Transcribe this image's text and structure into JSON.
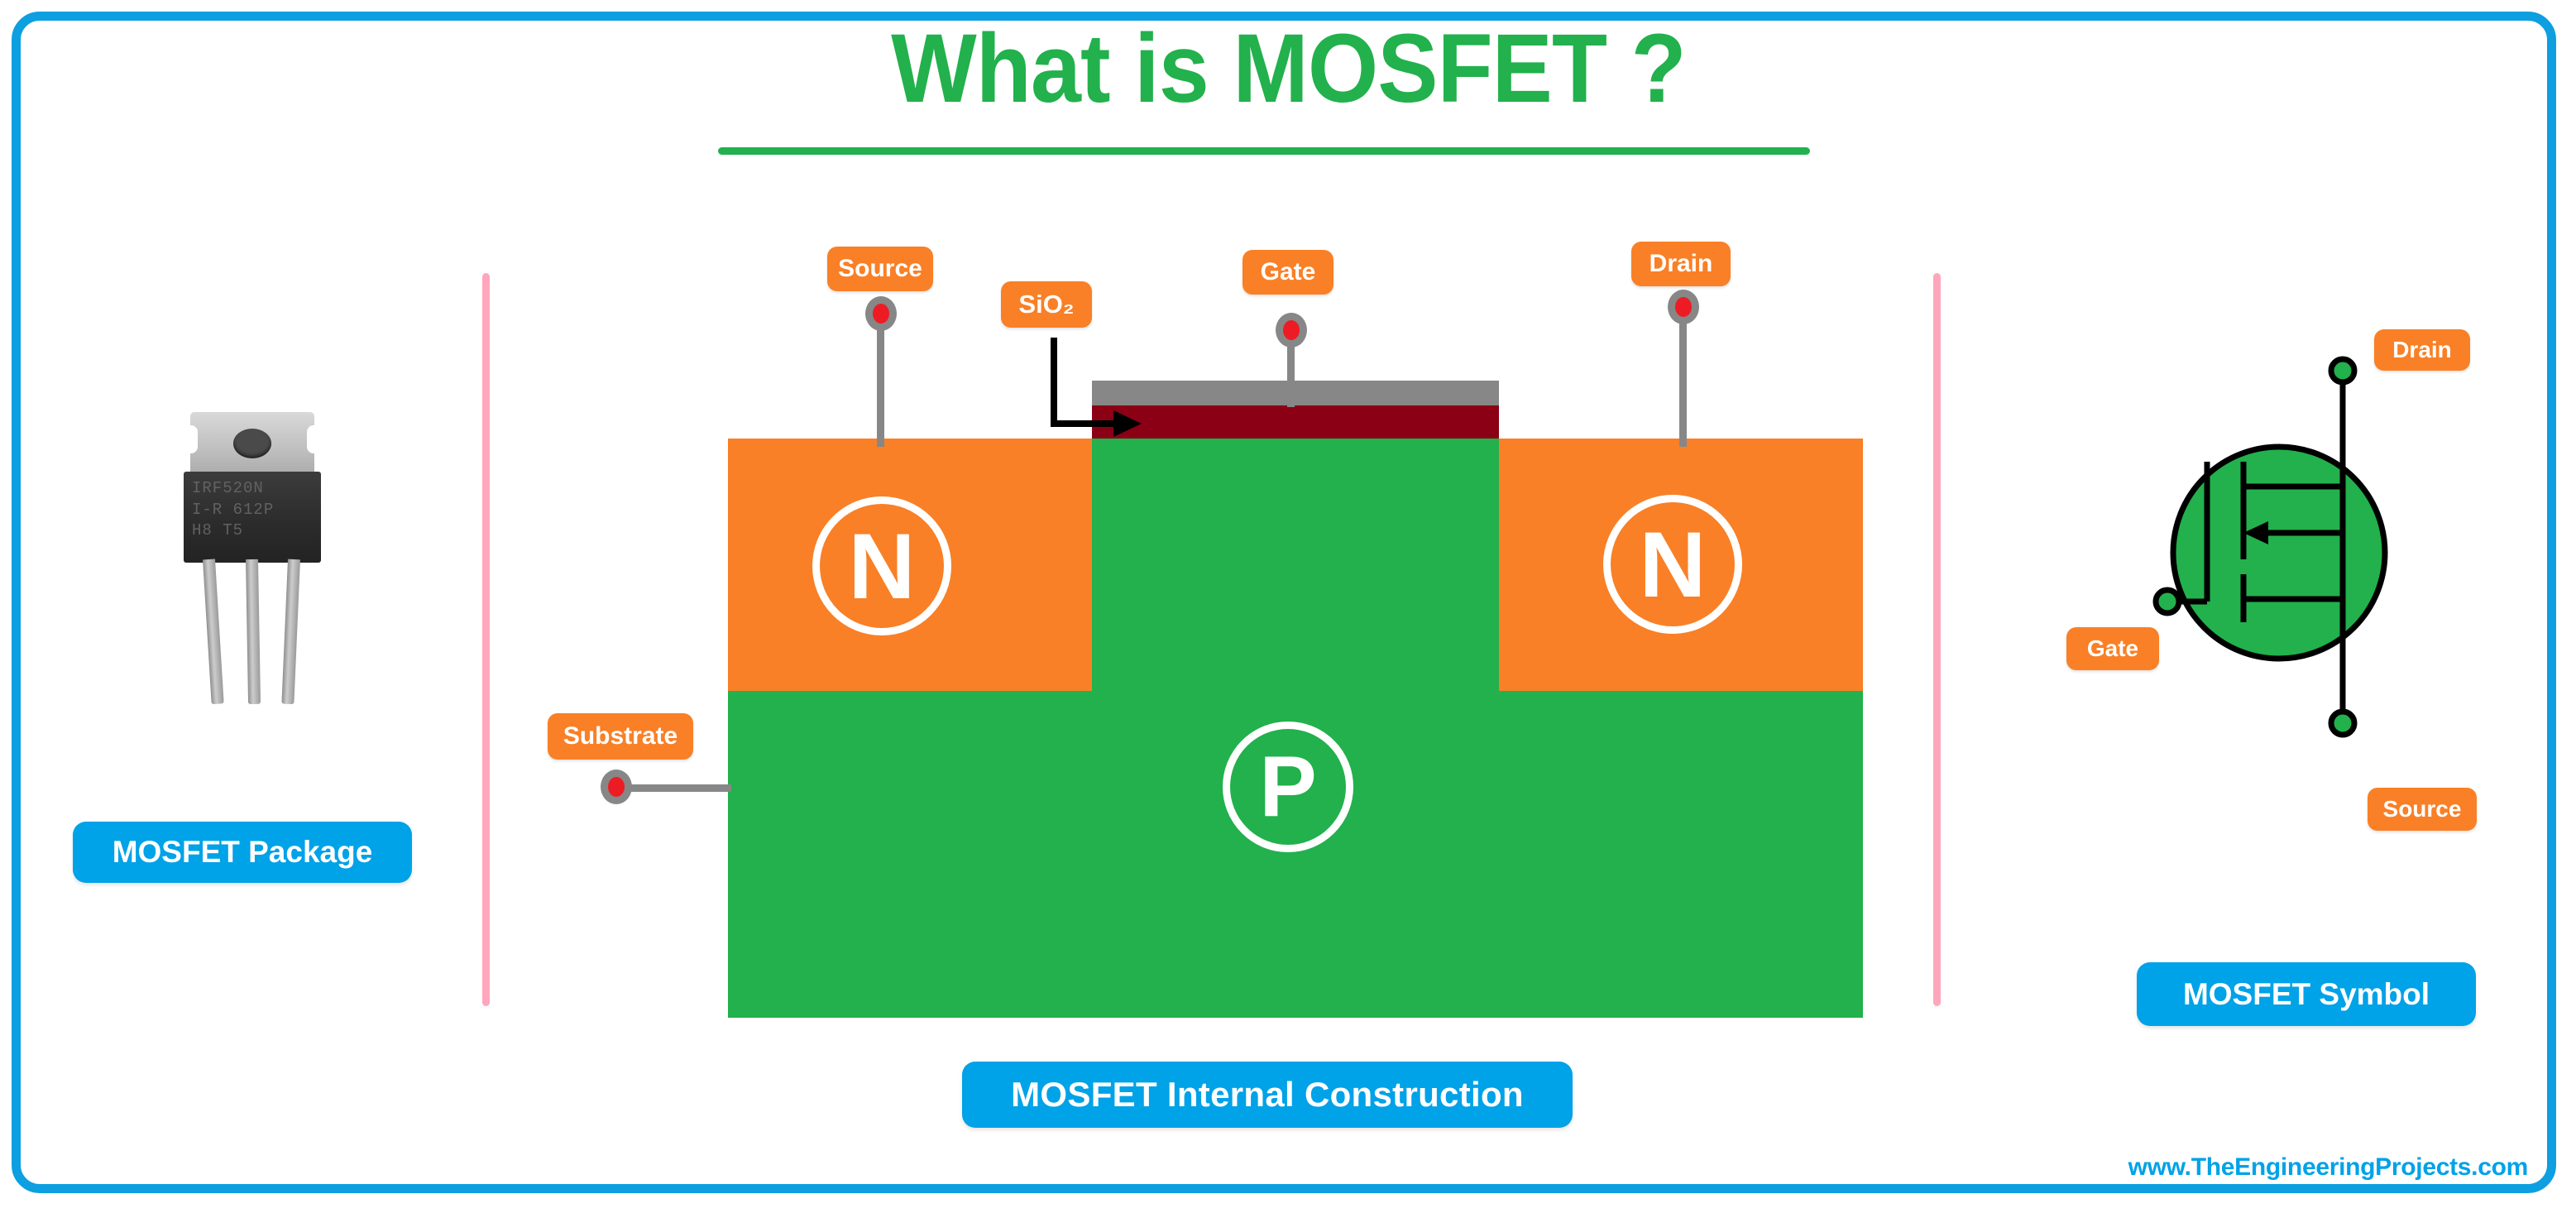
{
  "page": {
    "title": "What is MOSFET ?",
    "watermark": "www.TheEngineeringProjects.com"
  },
  "colors": {
    "green": "#22B14C",
    "orange": "#F98026",
    "blue": "#00A2E8",
    "frame_blue": "#0D9FE0",
    "oxide_red": "#8C0016",
    "metal_gray": "#878787",
    "terminal_red": "#ED1C24",
    "divider_pink": "#FFA6BD"
  },
  "package_section": {
    "caption": "MOSFET Package",
    "device_marking_line1": "IRF520N",
    "device_marking_line2": "I-R 612P",
    "device_marking_line3": "H8  T5"
  },
  "construction_section": {
    "caption": "MOSFET Internal Construction",
    "labels": {
      "source": "Source",
      "gate": "Gate",
      "drain": "Drain",
      "substrate": "Substrate",
      "oxide": "SiO₂"
    },
    "regions": {
      "n_left": "N",
      "n_right": "N",
      "p_body": "P"
    }
  },
  "symbol_section": {
    "caption": "MOSFET Symbol",
    "labels": {
      "drain": "Drain",
      "gate": "Gate",
      "source": "Source"
    }
  }
}
